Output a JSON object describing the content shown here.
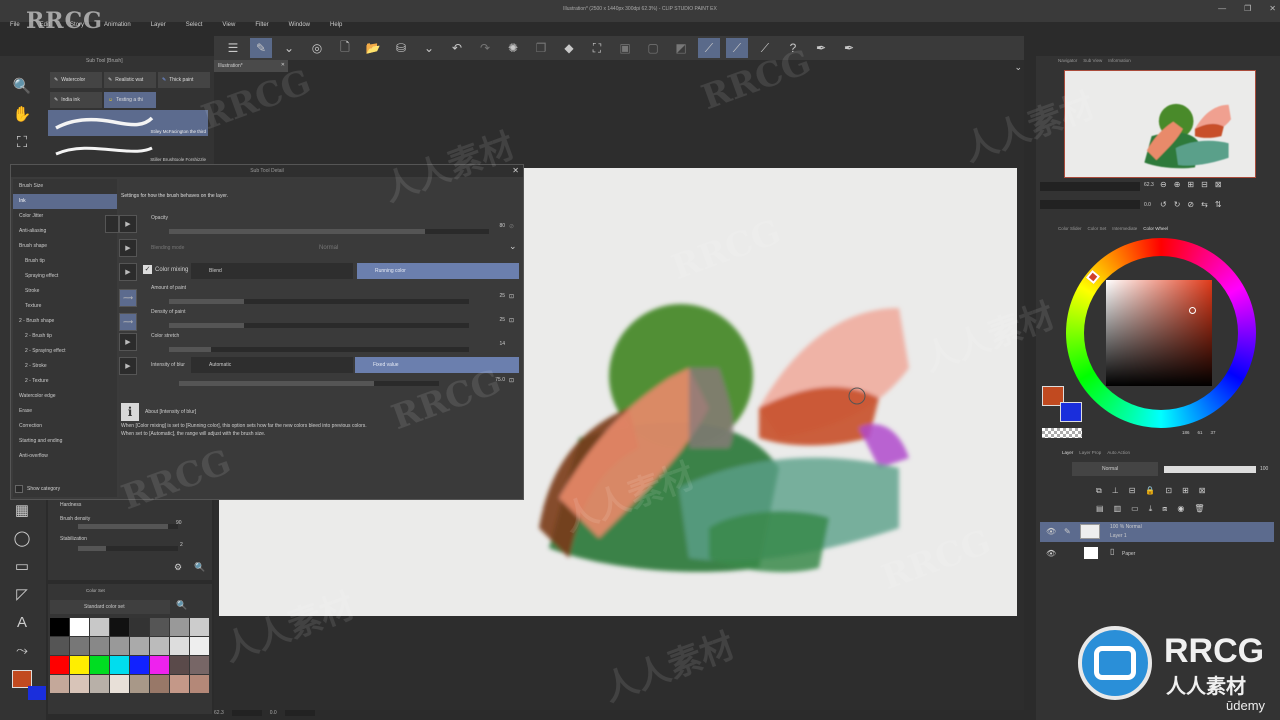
{
  "window": {
    "title": "Illustration* (2500 x 1440px 300dpi 62.3%) - CLIP STUDIO PAINT EX",
    "logo_text": "RRCG",
    "controls": [
      "—",
      "❐",
      "✕"
    ]
  },
  "menu": [
    "File",
    "Edit",
    "Story",
    "Animation",
    "Layer",
    "Select",
    "View",
    "Filter",
    "Window",
    "Help"
  ],
  "tab": {
    "label": "Illustration*"
  },
  "subtool": {
    "header": "Sub Tool [Brush]",
    "buttons": [
      "Watercolor",
      "Realistic wat",
      "Thick paint",
      "India ink",
      "Testing a thi"
    ],
    "brushes": [
      "Stiley McFacington the third",
      "Stiller Brushtoole Forshizzle"
    ]
  },
  "dialog": {
    "title": "Sub Tool Detail",
    "description": "Settings for how the brush behaves on the layer.",
    "categories": [
      "Brush Size",
      "Ink",
      "Color Jitter",
      "Anti-aliasing",
      "Brush shape",
      "Brush tip",
      "Spraying effect",
      "Stroke",
      "Texture",
      "2 - Brush shape",
      "2 - Brush tip",
      "2 - Spraying effect",
      "2 - Stroke",
      "2 - Texture",
      "Watercolor edge",
      "Erase",
      "Correction",
      "Starting and ending",
      "Anti-overflow"
    ],
    "selected_category": "Ink",
    "show_category": "Show category",
    "opacity": {
      "label": "Opacity",
      "value": "80",
      "fraction": 0.8
    },
    "blending": {
      "label": "Blending mode",
      "value": "Normal"
    },
    "color_mixing": {
      "label": "Color mixing",
      "options": [
        "Blend",
        "Running color"
      ],
      "selected": "Running color"
    },
    "amount_of_paint": {
      "label": "Amount of paint",
      "value": "25",
      "fraction": 0.25
    },
    "density_of_paint": {
      "label": "Density of paint",
      "value": "25",
      "fraction": 0.25
    },
    "color_stretch": {
      "label": "Color stretch",
      "value": "14",
      "fraction": 0.14
    },
    "intensity_of_blur": {
      "label": "Intensity of blur",
      "options": [
        "Automatic",
        "Fixed value"
      ],
      "selected": "Fixed value",
      "value": "75.0",
      "fraction": 0.75
    },
    "about_title": "About [Intensity of blur]",
    "about_text_1": "When [Color mixing] is set to [Running color], this option sets how far the new colors bleed into previous colors.",
    "about_text_2": "When set to [Automatic], the range will adjust with the brush size."
  },
  "tool_property": {
    "hardness_label": "Hardness",
    "brush_density_label": "Brush density",
    "brush_density_value": "90",
    "stabilization_label": "Stabilization",
    "stabilization_value": "2"
  },
  "colorset": {
    "header": "Color Set",
    "set_name": "Standard color set",
    "swatches": [
      [
        "#000000",
        "#ffffff",
        "#c8c8c8",
        "#111111",
        "#333333",
        "#555555",
        "#999999",
        "#cccccc"
      ],
      [
        "#555555",
        "#777777",
        "#888888",
        "#999999",
        "#aaaaaa",
        "#bbbbbb",
        "#dddddd",
        "#eeeeee"
      ],
      [
        "#ff0000",
        "#ffee00",
        "#00dd22",
        "#00ddee",
        "#1122ff",
        "#ee22ee",
        "#5a4a4a",
        "#776666"
      ],
      [
        "#c4a89a",
        "#d8c4b8",
        "#b8b0a8",
        "#e8e0d8",
        "#a89888",
        "#987868",
        "#c49888",
        "#b48878"
      ]
    ]
  },
  "navigator": {
    "tabs": [
      "Navigator",
      "Sub View",
      "Information"
    ],
    "zoom": "62.3",
    "rotation": "0.0"
  },
  "color_panel": {
    "tabs": [
      "Color Slider",
      "Color Set",
      "Intermediate",
      "Color Wheel"
    ],
    "main_color": "#c14a20",
    "sub_color": "#1a2edc",
    "hue_marker_color": "#d0402a",
    "rgb_values": [
      "186",
      "61",
      "37"
    ]
  },
  "layers": {
    "tabs": [
      "Layer",
      "Layer Prop",
      "Auto Action"
    ],
    "blend_mode": "Normal",
    "opacity_value": "100",
    "items": [
      {
        "name": "Layer 1",
        "detail": "100 % Normal",
        "selected": true
      },
      {
        "name": "Paper",
        "detail": "",
        "selected": false
      }
    ]
  },
  "status": {
    "zoom": "62.3",
    "angle": "0.0"
  },
  "watermarks": [
    "RRCG",
    "人人素材",
    "RRCG",
    "人人素材",
    "RRCG",
    "人人素材",
    "RRCG",
    "人人素材",
    "RRCG",
    "人人素材",
    "RRCG",
    "人人素材"
  ],
  "brand": {
    "rrcg": "RRCG",
    "chinese": "人人素材",
    "udemy": "ūdemy"
  }
}
